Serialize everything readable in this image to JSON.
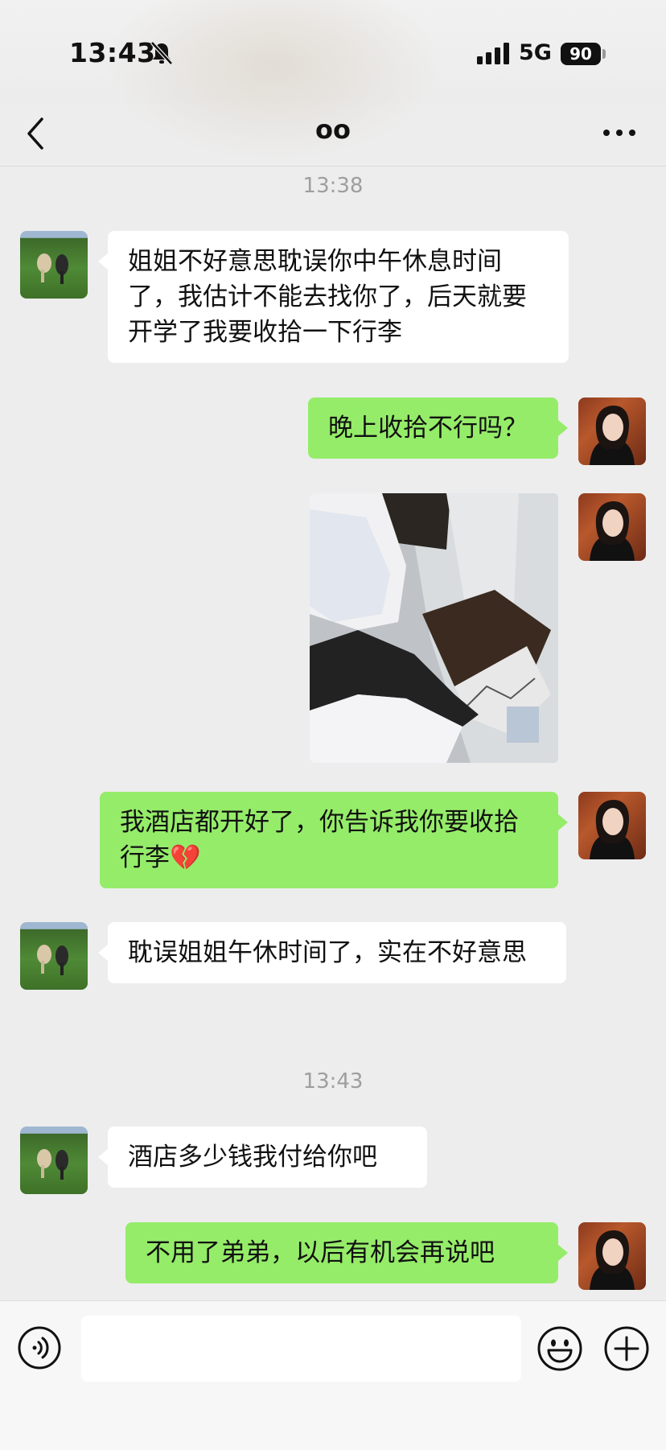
{
  "status": {
    "time": "13:43",
    "network": "5G",
    "battery": "90"
  },
  "header": {
    "title": "oo"
  },
  "messages": {
    "ts1": "13:38",
    "m1": "姐姐不好意思耽误你中午休息时间了，我估计不能去找你了，后天就要开学了我要收拾一下行李",
    "m2": "晚上收拾不行吗？",
    "m4": "我酒店都开好了，你告诉我你要收拾行李💔",
    "m5": "耽误姐姐午休时间了，实在不好意思",
    "ts2": "13:43",
    "m6": "酒店多少钱我付给你吧",
    "m7": "不用了弟弟，以后有机会再说吧"
  },
  "colors": {
    "self_bubble": "#95ec69",
    "other_bubble": "#ffffff",
    "background": "#ededed"
  }
}
